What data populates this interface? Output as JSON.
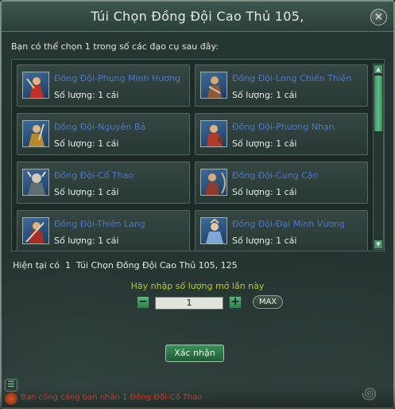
{
  "dialog": {
    "title": "Túi Chọn Đồng Đội Cao Thủ 105,",
    "close_symbol": "×",
    "instruction": "Bạn có thể chọn 1 trong số các đạo cụ sau đây:"
  },
  "items": [
    {
      "name": "Đồng Đội-Phụng Minh Hương",
      "qty": "Số lượng: 1 cái",
      "icon": "red-warrior-icon"
    },
    {
      "name": "Đồng Đội-Long Chiến Thiên",
      "qty": "Số lượng: 1 cái",
      "icon": "armored-warrior-icon"
    },
    {
      "name": "Đồng Đội-Nguyên Bá",
      "qty": "Số lượng: 1 cái",
      "icon": "golden-warrior-icon"
    },
    {
      "name": "Đồng Đội-Phương Nhạn",
      "qty": "Số lượng: 1 cái",
      "icon": "red-rider-icon"
    },
    {
      "name": "Đồng Đội-Cổ Thao",
      "qty": "Số lượng: 1 cái",
      "icon": "beast-warrior-icon"
    },
    {
      "name": "Đồng Đội-Cung Cận",
      "qty": "Số lượng: 1 cái",
      "icon": "archer-icon"
    },
    {
      "name": "Đồng Đội-Thiên Lang",
      "qty": "Số lượng: 1 cái",
      "icon": "red-swordsman-icon"
    },
    {
      "name": "Đồng Đội-Đại Minh Vương",
      "qty": "Số lượng: 1 cái",
      "icon": "blue-king-icon"
    }
  ],
  "current": {
    "text": "Hiện tại có  1  Túi Chọn Đồng Đội Cao Thủ 105, 125"
  },
  "quantity": {
    "prompt": "Hãy nhập số lượng mở lần này",
    "value": "1",
    "minus": "−",
    "plus": "+",
    "max_label": "MAX"
  },
  "confirm_label": "Xác nhận",
  "status": {
    "message": "Bạn cũng cảng bạn nhận 1 Đồng Đội-Cổ Thao"
  },
  "colors": {
    "item_name": "#4d79c8",
    "prompt": "#b7c92f",
    "status": "#e0321c",
    "accent_green": "#3e8e59"
  }
}
